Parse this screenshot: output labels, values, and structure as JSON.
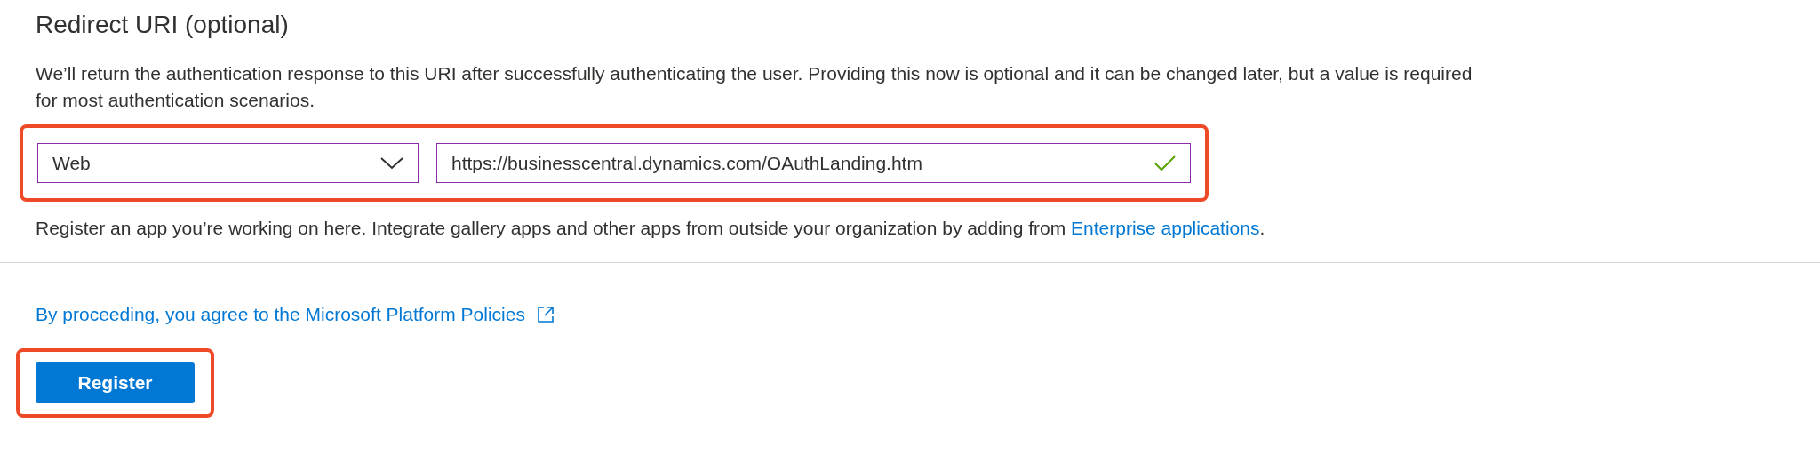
{
  "section": {
    "title": "Redirect URI (optional)",
    "description": "We’ll return the authentication response to this URI after successfully authenticating the user. Providing this now is optional and it can be changed later, but a value is required for most authentication scenarios."
  },
  "platform_select": {
    "value": "Web"
  },
  "uri_field": {
    "value": "https://businesscentral.dynamics.com/OAuthLanding.htm",
    "valid": true
  },
  "hint": {
    "text": "Register an app you’re working on here. Integrate gallery apps and other apps from outside your organization by adding from ",
    "link": "Enterprise applications",
    "end": "."
  },
  "policy_link": "By proceeding, you agree to the Microsoft Platform Policies",
  "register_button": "Register"
}
